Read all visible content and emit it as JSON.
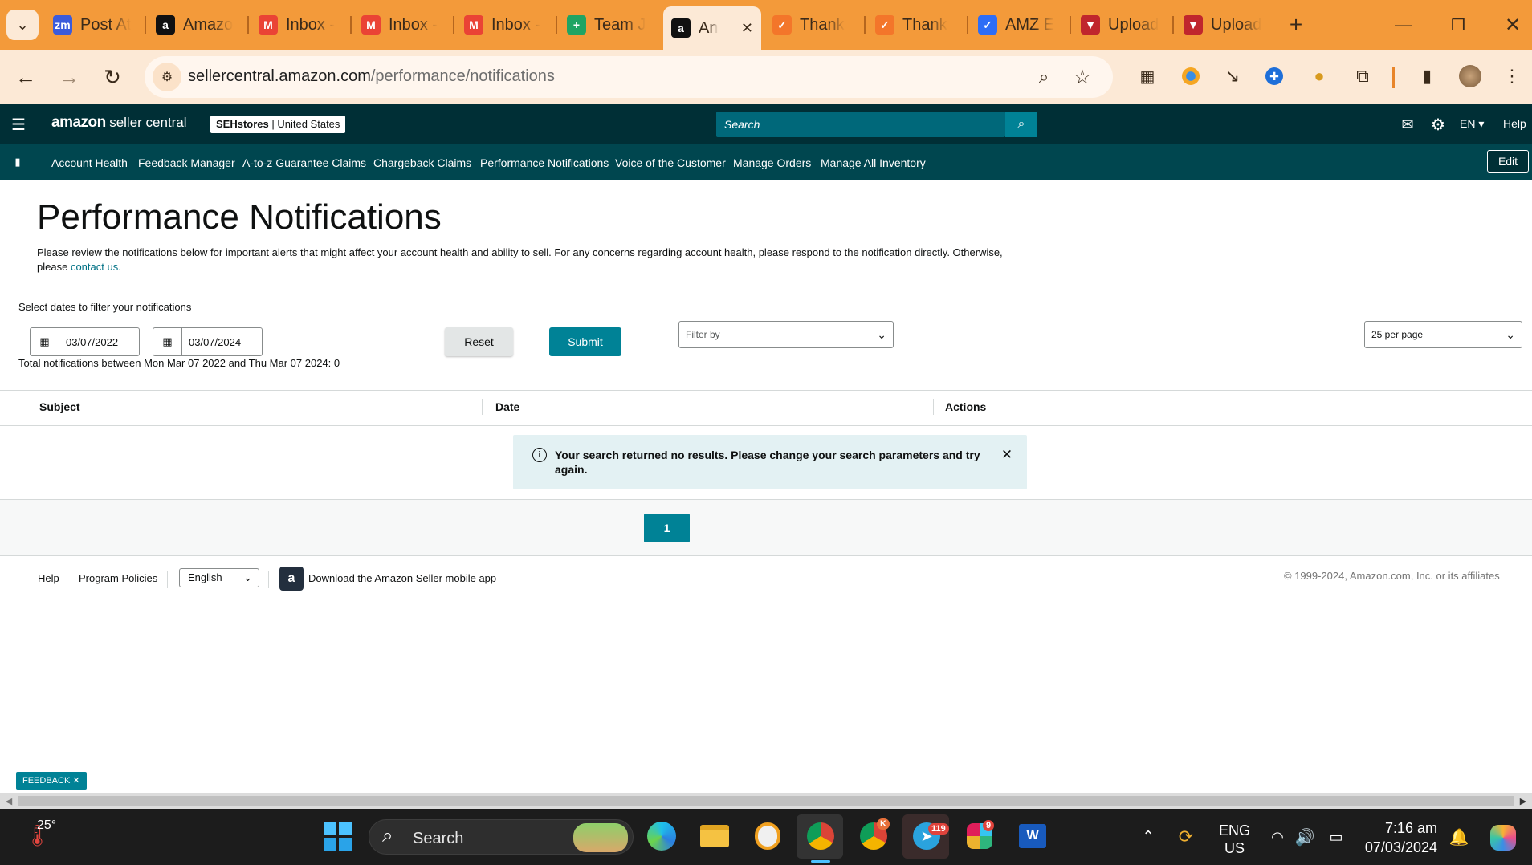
{
  "browser": {
    "tabs": [
      {
        "label": "Post At",
        "fav": "zm",
        "color": "#3b5bdb"
      },
      {
        "label": "Amazo",
        "fav": "a",
        "color": "#111"
      },
      {
        "label": "Inbox -",
        "fav": "M",
        "color": "#ea4335"
      },
      {
        "label": "Inbox -",
        "fav": "M",
        "color": "#ea4335"
      },
      {
        "label": "Inbox -",
        "fav": "M",
        "color": "#ea4335"
      },
      {
        "label": "Team J",
        "fav": "+",
        "color": "#1fa463"
      },
      {
        "label": "An",
        "fav": "a",
        "color": "#111"
      },
      {
        "label": "Thank",
        "fav": "✓",
        "color": "#f3762a"
      },
      {
        "label": "Thank",
        "fav": "✓",
        "color": "#f3762a"
      },
      {
        "label": "AMZ E",
        "fav": "✓",
        "color": "#2d6df6"
      },
      {
        "label": "Upload",
        "fav": "▼",
        "color": "#c0262d"
      },
      {
        "label": "Upload",
        "fav": "▼",
        "color": "#c0262d"
      }
    ],
    "url_domain": "sellercentral.amazon.com",
    "url_path": "/performance/notifications"
  },
  "header": {
    "logo_main": "amazon",
    "logo_sub": "seller central",
    "store_name": "SEHstores",
    "store_region": "| United States",
    "search_placeholder": "Search",
    "lang": "EN",
    "help": "Help"
  },
  "nav": {
    "items": [
      "Account Health",
      "Feedback Manager",
      "A-to-z Guarantee Claims",
      "Chargeback Claims",
      "Performance Notifications",
      "Voice of the Customer",
      "Manage Orders",
      "Manage All Inventory"
    ],
    "edit": "Edit"
  },
  "page": {
    "title": "Performance Notifications",
    "intro": "Please review the notifications below for important alerts that might affect your account health and ability to sell. For any concerns regarding account health, please respond to the notification directly. Otherwise, please",
    "contact_link": "contact us.",
    "filter_label": "Select dates to filter your notifications",
    "date_from": "03/07/2022",
    "date_to": "03/07/2024",
    "reset": "Reset",
    "submit": "Submit",
    "filter_by": "Filter by",
    "per_page": "25 per page",
    "total": "Total notifications between Mon Mar 07 2022 and Thu Mar 07 2024: 0",
    "columns": [
      "Subject",
      "Date",
      "Actions"
    ],
    "alert": "Your search returned no results. Please change your search parameters and try again.",
    "page_number": "1"
  },
  "footer": {
    "help": "Help",
    "policies": "Program Policies",
    "language": "English",
    "app": "Download the Amazon Seller mobile app",
    "copyright": "© 1999-2024, Amazon.com, Inc. or its affiliates",
    "feedback": "FEEDBACK"
  },
  "taskbar": {
    "temp": "25°",
    "search": "Search",
    "lang1": "ENG",
    "lang2": "US",
    "time": "7:16 am",
    "date": "07/03/2024",
    "telegram_badge": "119",
    "slack_badge": "9",
    "chrome2_badge": "K"
  }
}
